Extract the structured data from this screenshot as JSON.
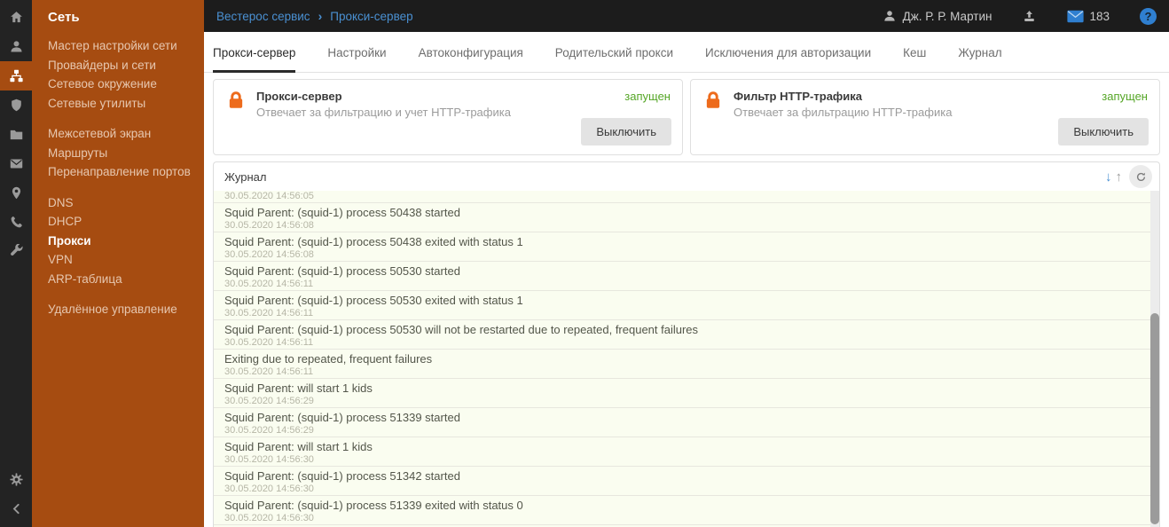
{
  "colors": {
    "accent_orange": "#a64c11",
    "lock_orange": "#ed6b1c",
    "link_blue": "#4a90d2",
    "status_green": "#55a626",
    "topbar_bg": "#1c1c1c",
    "rail_bg": "#232323",
    "log_row_bg": "#fafdf0"
  },
  "icon_rail": {
    "items": [
      "home",
      "user",
      "network",
      "shield",
      "folder",
      "mail",
      "location",
      "phone",
      "tools"
    ],
    "active": "network",
    "bottom": [
      "settings",
      "collapse"
    ]
  },
  "sidebar": {
    "title": "Сеть",
    "active_label": "Прокси",
    "groups": [
      [
        "Мастер настройки сети",
        "Провайдеры и сети",
        "Сетевое окружение",
        "Сетевые утилиты"
      ],
      [
        "Межсетевой экран",
        "Маршруты",
        "Перенаправление портов"
      ],
      [
        "DNS",
        "DHCP",
        "Прокси",
        "VPN",
        "ARP-таблица"
      ],
      [
        "Удалённое управление"
      ]
    ]
  },
  "topbar": {
    "breadcrumb": {
      "home": "Вестерос сервис",
      "separator": "›",
      "current": "Прокси-сервер"
    },
    "user_name": "Дж. Р. Р. Мартин",
    "mail_count": "183",
    "help_label": "?"
  },
  "tabs": {
    "active_index": 0,
    "items": [
      "Прокси-сервер",
      "Настройки",
      "Автоконфигурация",
      "Родительский прокси",
      "Исключения для авторизации",
      "Кеш",
      "Журнал"
    ]
  },
  "cards": [
    {
      "title": "Прокси-сервер",
      "subtitle": "Отвечает за фильтрацию и учет HTTP-трафика",
      "status": "запущен",
      "button": "Выключить"
    },
    {
      "title": "Фильтр HTTP-трафика",
      "subtitle": "Отвечает за фильтрацию HTTP-трафика",
      "status": "запущен",
      "button": "Выключить"
    }
  ],
  "journal": {
    "title": "Журнал",
    "partial_top_timestamp": "30.05.2020 14:56:05",
    "entries": [
      {
        "message": "Squid Parent: (squid-1) process 50438 started",
        "timestamp": "30.05.2020 14:56:08"
      },
      {
        "message": "Squid Parent: (squid-1) process 50438 exited with status 1",
        "timestamp": "30.05.2020 14:56:08"
      },
      {
        "message": "Squid Parent: (squid-1) process 50530 started",
        "timestamp": "30.05.2020 14:56:11"
      },
      {
        "message": "Squid Parent: (squid-1) process 50530 exited with status 1",
        "timestamp": "30.05.2020 14:56:11"
      },
      {
        "message": "Squid Parent: (squid-1) process 50530 will not be restarted due to repeated, frequent failures",
        "timestamp": "30.05.2020 14:56:11"
      },
      {
        "message": "Exiting due to repeated, frequent failures",
        "timestamp": "30.05.2020 14:56:11"
      },
      {
        "message": "Squid Parent: will start 1 kids",
        "timestamp": "30.05.2020 14:56:29"
      },
      {
        "message": "Squid Parent: (squid-1) process 51339 started",
        "timestamp": "30.05.2020 14:56:29"
      },
      {
        "message": "Squid Parent: will start 1 kids",
        "timestamp": "30.05.2020 14:56:30"
      },
      {
        "message": "Squid Parent: (squid-1) process 51342 started",
        "timestamp": "30.05.2020 14:56:30"
      },
      {
        "message": "Squid Parent: (squid-1) process 51339 exited with status 0",
        "timestamp": "30.05.2020 14:56:30"
      }
    ]
  }
}
